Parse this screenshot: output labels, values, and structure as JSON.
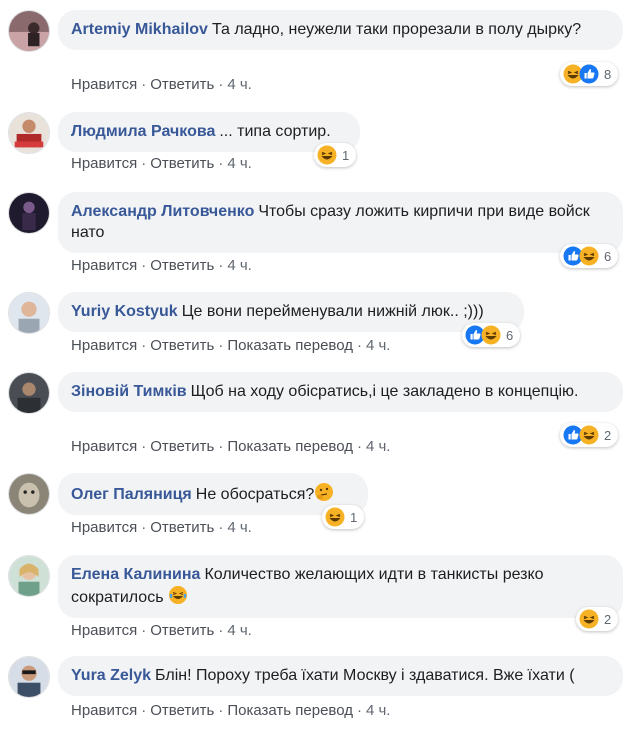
{
  "labels": {
    "like": "Нравится",
    "reply": "Ответить",
    "translate": "Показать перевод"
  },
  "comments": [
    {
      "author": "Artemiy Mikhailov",
      "text": "Та ладно, неужели таки прорезали в полу дырку?",
      "time": "4 ч.",
      "reactions": [
        "haha-icon",
        "like-icon"
      ],
      "reaction_count": "8",
      "has_translate": false
    },
    {
      "author": "Людмила Рачкова",
      "text": "... типа сортир.",
      "time": "4 ч.",
      "reactions": [
        "haha-icon"
      ],
      "reaction_count": "1",
      "has_translate": false
    },
    {
      "author": "Александр Литовченко",
      "text": "Чтобы сразу ложить кирпичи при виде войск нато",
      "time": "4 ч.",
      "reactions": [
        "like-icon",
        "haha-icon"
      ],
      "reaction_count": "6",
      "has_translate": false
    },
    {
      "author": "Yuriy Kostyuk",
      "text": "Це вони перейменували нижній люк.. ;)))",
      "time": "4 ч.",
      "reactions": [
        "like-icon",
        "haha-icon"
      ],
      "reaction_count": "6",
      "has_translate": true
    },
    {
      "author": "Зіновій Тимків",
      "text": "Щоб на ходу обісратись,і це закладено в концепцію.",
      "time": "4 ч.",
      "reactions": [
        "like-icon",
        "haha-icon"
      ],
      "reaction_count": "2",
      "has_translate": true
    },
    {
      "author": "Олег Паляниця",
      "text": "Не обосраться?",
      "inline_emoji": "thinking-emoji",
      "time": "4 ч.",
      "reactions": [
        "haha-icon"
      ],
      "reaction_count": "1",
      "has_translate": false
    },
    {
      "author": "Елена Калинина",
      "text": "Количество желающих идти в танкисты резко сократилось",
      "inline_emoji": "tears-of-joy-emoji",
      "time": "4 ч.",
      "reactions": [
        "haha-icon"
      ],
      "reaction_count": "2",
      "has_translate": false
    },
    {
      "author": "Yura Zelyk",
      "text": "Блін! Пороху треба їхати Москву і здаватися. Вже їхати (",
      "time": "4 ч.",
      "reactions": [],
      "reaction_count": "",
      "has_translate": true
    }
  ],
  "colors": {
    "author": "#385898",
    "bubble": "#f2f3f5",
    "action": "#4b4f56",
    "like_blue": "#1877f2",
    "haha_yellow": "#f7b125"
  }
}
